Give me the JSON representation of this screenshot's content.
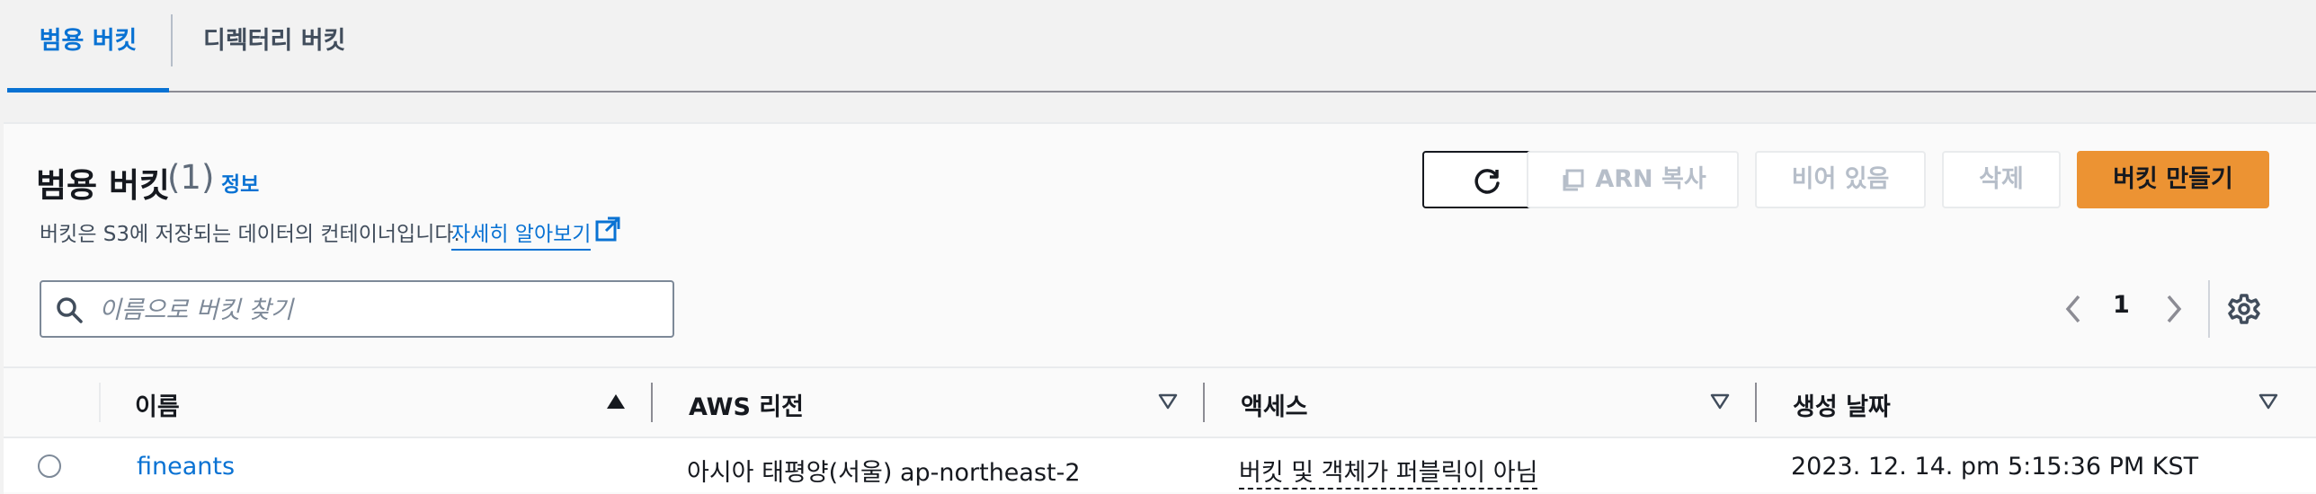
{
  "tabs": {
    "general": "범용 버킷",
    "directory": "디렉터리 버킷"
  },
  "panel": {
    "title": "범용 버킷",
    "count": "(1)",
    "info": "정보",
    "description": "버킷은 S3에 저장되는 데이터의 컨테이너입니다.",
    "learn_more": "자세히 알아보기",
    "learn_more_icon": "external-link-icon"
  },
  "toolbar": {
    "refresh_icon": "refresh-icon",
    "copy_arn": "ARN 복사",
    "copy_icon": "copy-icon",
    "empty": "비어 있음",
    "delete": "삭제",
    "create": "버킷 만들기"
  },
  "search": {
    "placeholder": "이름으로 버킷 찾기",
    "value": ""
  },
  "pagination": {
    "current_page": "1"
  },
  "table": {
    "columns": [
      "이름",
      "AWS 리전",
      "액세스",
      "생성 날짜"
    ],
    "rows": [
      {
        "name": "fineants",
        "region": "아시아 태평양(서울) ap-northeast-2",
        "access": "버킷 및 객체가 퍼블릭이 아님",
        "created": "2023. 12. 14. pm 5:15:36 PM KST"
      }
    ]
  },
  "colors": {
    "link": "#0972d3",
    "primary_button": "#ec9333",
    "disabled_text": "#b6bec9"
  }
}
